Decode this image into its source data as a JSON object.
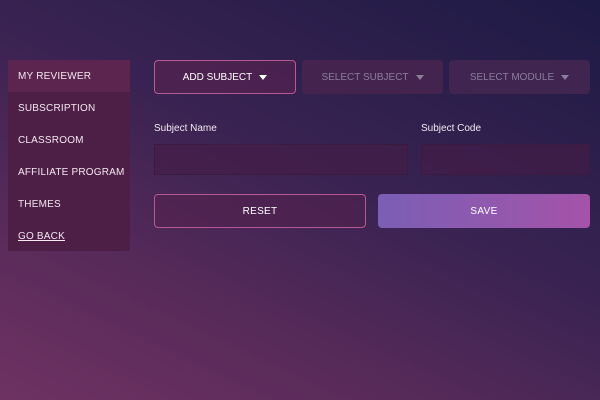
{
  "sidebar": {
    "items": [
      {
        "label": "MY REVIEWER"
      },
      {
        "label": "SUBSCRIPTION"
      },
      {
        "label": "CLASSROOM"
      },
      {
        "label": "AFFILIATE PROGRAM"
      },
      {
        "label": "THEMES"
      },
      {
        "label": "GO BACK"
      }
    ]
  },
  "toolbar": {
    "add_subject": "ADD SUBJECT",
    "select_subject": "SELECT SUBJECT",
    "select_module": "SELECT MODULE"
  },
  "form": {
    "subject_name_label": "Subject Name",
    "subject_name_value": "",
    "subject_code_label": "Subject Code",
    "subject_code_value": "",
    "reset_label": "RESET",
    "save_label": "SAVE"
  }
}
